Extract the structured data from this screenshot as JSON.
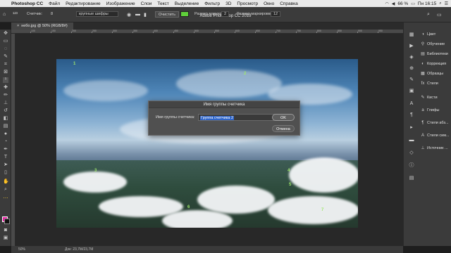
{
  "menubar": {
    "app": "Photoshop CC",
    "items": [
      "Файл",
      "Редактирование",
      "Изображение",
      "Слои",
      "Текст",
      "Выделение",
      "Фильтр",
      "3D",
      "Просмотр",
      "Окно",
      "Справка"
    ],
    "battery": "66 %",
    "day_time": "Пн 16:15"
  },
  "window_title": "Adobe Photoshop CC 2019",
  "options": {
    "counter_label": "Счетчик:",
    "counter_value": "8",
    "font_label": "крупные шифры",
    "clear_label": "Очистить",
    "marker_size_label": "Размер маркера:",
    "marker_size_value": "2",
    "marker_color": "#5fcf3a",
    "marker_size2_label": "Размер маркировки:",
    "marker_size2_value": "12"
  },
  "document_tab": "небо.jpg @ 50% (RGB/8#)",
  "ruler_labels": [
    "100",
    "150",
    "200",
    "250",
    "300",
    "350",
    "400",
    "450",
    "500",
    "550",
    "600",
    "650",
    "700",
    "750",
    "800",
    "850",
    "900",
    "950",
    "1000"
  ],
  "canvas_markers": [
    "1",
    "2",
    "3",
    "4",
    "5",
    "6",
    "7"
  ],
  "dialog": {
    "title": "Имя группы счетчика",
    "label": "Имя группы счетчика:",
    "value": "Группа счетчика 2",
    "ok": "OK",
    "cancel": "Отмена"
  },
  "panels": [
    {
      "icon": "color",
      "label": "Цвет"
    },
    {
      "icon": "learn",
      "label": "Обучение"
    },
    {
      "icon": "libraries",
      "label": "Библиотеки"
    },
    {
      "icon": "adjustments",
      "label": "Коррекция"
    },
    {
      "icon": "swatches",
      "label": "Образцы"
    },
    {
      "icon": "styles",
      "label": "Стили"
    },
    {
      "icon": "brushes",
      "label": "Кисти"
    },
    {
      "icon": "glyphs",
      "label": "Глифы"
    },
    {
      "icon": "para-styles",
      "label": "Стили абз..."
    },
    {
      "icon": "char-styles",
      "label": "Стили сим..."
    },
    {
      "icon": "clone-source",
      "label": "Источник ..."
    }
  ],
  "status": {
    "zoom": "50%",
    "doc": "Док: 23,7M/23,7M"
  },
  "colors": {
    "foreground": "#e81ca0",
    "background": "#111111",
    "selection": "#2f65c9"
  }
}
